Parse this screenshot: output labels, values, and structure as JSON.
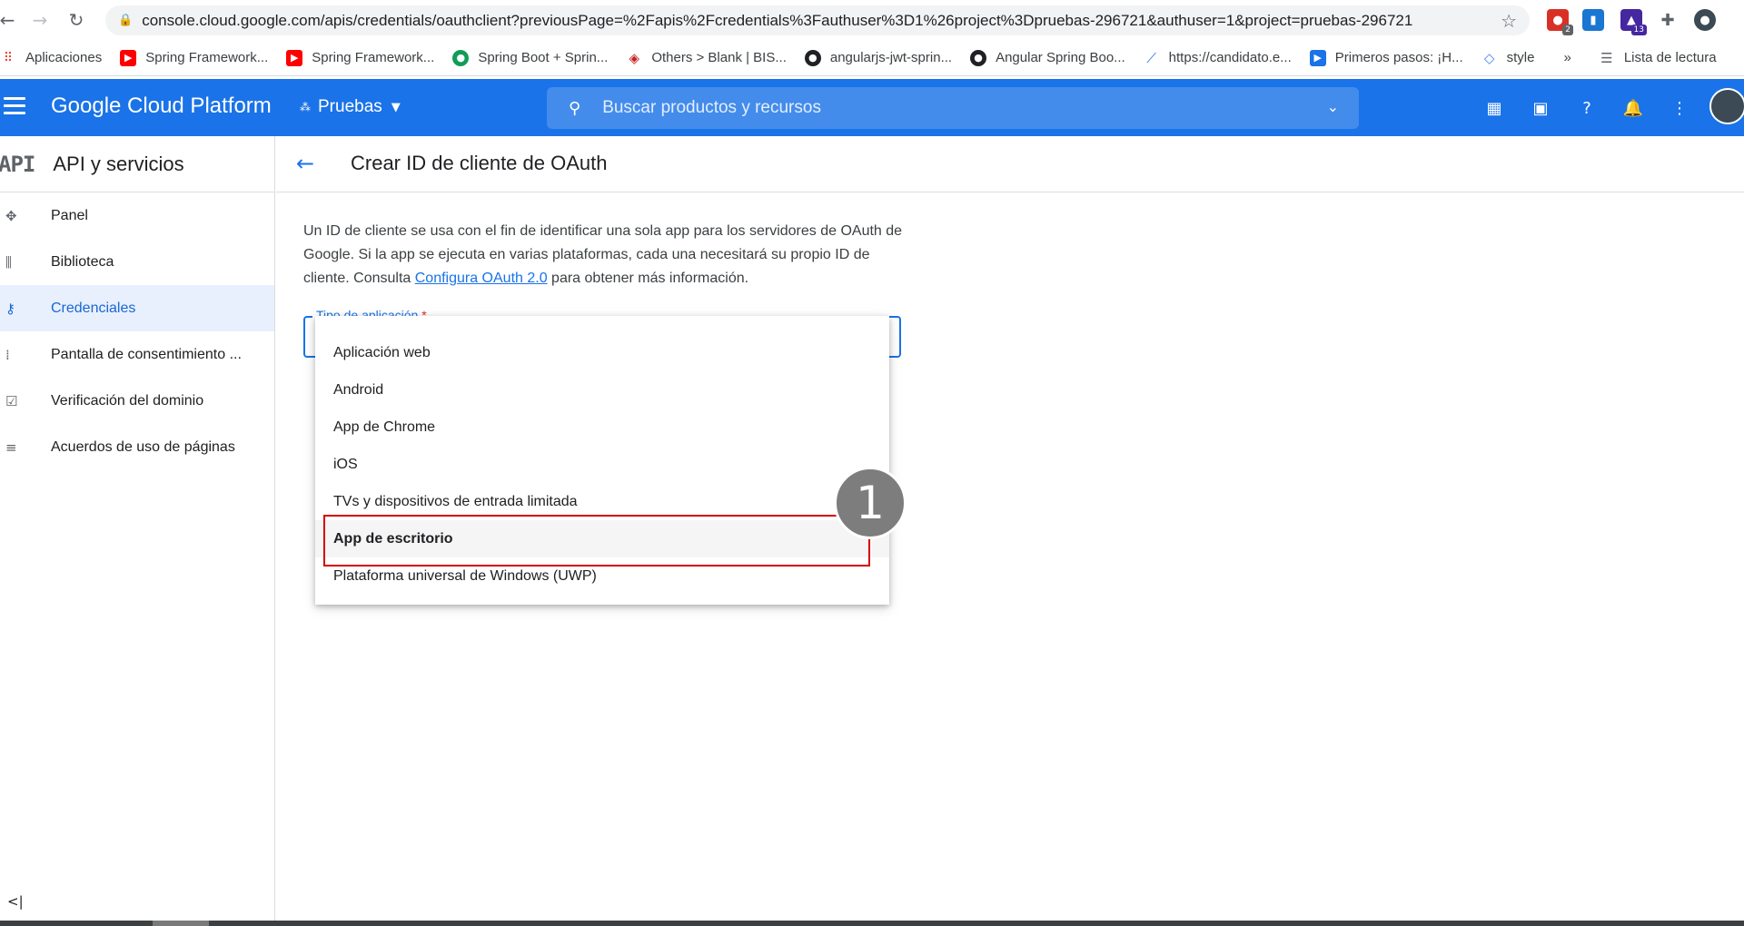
{
  "browser": {
    "url": "console.cloud.google.com/apis/credentials/oauthclient?previousPage=%2Fapis%2Fcredentials%3Fauthuser%3D1%26project%3Dpruebas-296721&authuser=1&project=pruebas-296721",
    "extension_badges": [
      "2",
      "13"
    ]
  },
  "bookmarks": [
    {
      "label": "Aplicaciones",
      "icon": "apps-grid-icon"
    },
    {
      "label": "Spring Framework...",
      "icon": "youtube-icon"
    },
    {
      "label": "Spring Framework...",
      "icon": "youtube-icon"
    },
    {
      "label": "Spring Boot + Sprin...",
      "icon": "green-circle-icon"
    },
    {
      "label": "Others > Blank | BIS...",
      "icon": "cube-icon"
    },
    {
      "label": "angularjs-jwt-sprin...",
      "icon": "github-icon"
    },
    {
      "label": "Angular Spring Boo...",
      "icon": "github-icon"
    },
    {
      "label": "https://candidato.e...",
      "icon": "chart-icon"
    },
    {
      "label": "Primeros pasos: ¡H...",
      "icon": "play-icon"
    },
    {
      "label": "style",
      "icon": "diamond-icon"
    },
    {
      "label": "»",
      "icon": ""
    },
    {
      "label": "Lista de lectura",
      "icon": "reading-list-icon"
    }
  ],
  "header": {
    "title": "Google Cloud Platform",
    "project": "Pruebas",
    "search_placeholder": "Buscar productos y recursos"
  },
  "sidebar": {
    "logo": "API",
    "title": "API y servicios",
    "items": [
      {
        "label": "Panel",
        "icon": "dashboard-icon",
        "active": false
      },
      {
        "label": "Biblioteca",
        "icon": "library-icon",
        "active": false
      },
      {
        "label": "Credenciales",
        "icon": "key-icon",
        "active": true
      },
      {
        "label": "Pantalla de consentimiento ...",
        "icon": "consent-icon",
        "active": false
      },
      {
        "label": "Verificación del dominio",
        "icon": "checkbox-icon",
        "active": false
      },
      {
        "label": "Acuerdos de uso de páginas",
        "icon": "settings-list-icon",
        "active": false
      }
    ],
    "collapse": "<|"
  },
  "main": {
    "title": "Crear ID de cliente de OAuth",
    "intro_before_link": "Un ID de cliente se usa con el fin de identificar una sola app para los servidores de OAuth de Google. Si la app se ejecuta en varias plataformas, cada una necesitará su propio ID de cliente. Consulta ",
    "intro_link": "Configura OAuth 2.0",
    "intro_after_link": " para obtener más información.",
    "field_label": "Tipo de aplicación",
    "field_required": "*",
    "options": [
      "Aplicación web",
      "Android",
      "App de Chrome",
      "iOS",
      "TVs y dispositivos de entrada limitada",
      "App de escritorio",
      "Plataforma universal de Windows (UWP)"
    ],
    "highlighted_option": "App de escritorio",
    "step_number": "1"
  },
  "colors": {
    "brand": "#1a73e8",
    "highlight": "#d50000",
    "step_badge": "#7d7d7d"
  }
}
